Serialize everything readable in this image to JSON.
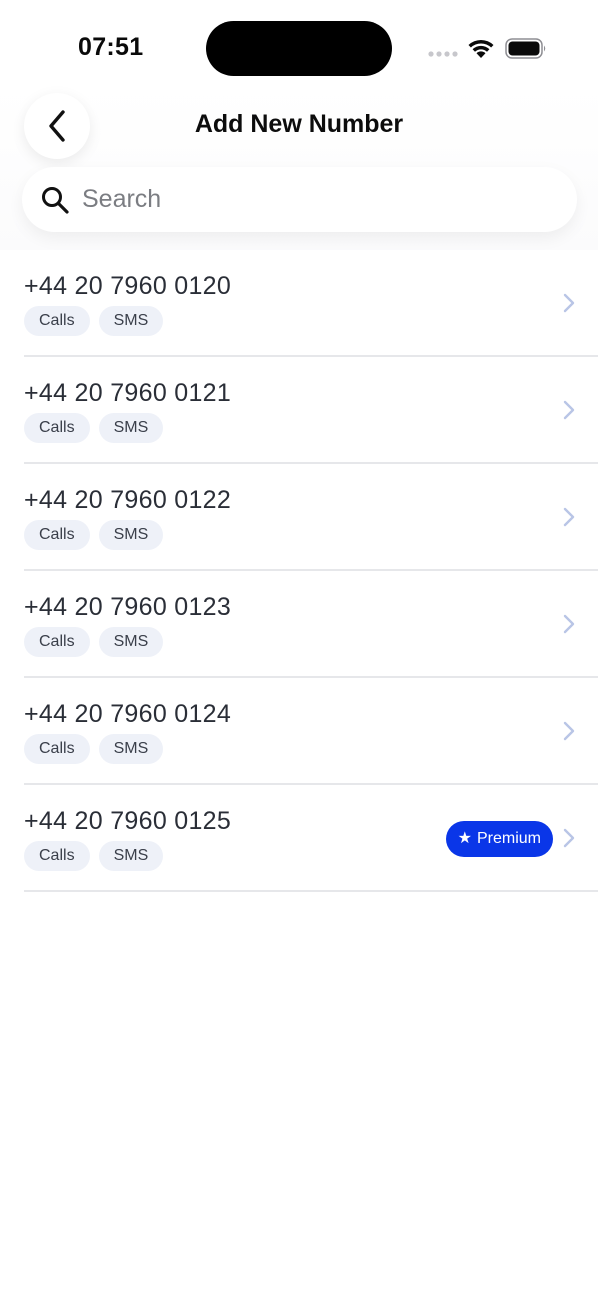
{
  "status_bar": {
    "time": "07:51"
  },
  "header": {
    "title": "Add New Number"
  },
  "search": {
    "placeholder": "Search",
    "value": ""
  },
  "numbers": [
    {
      "number": "+44 20 7960 0120",
      "tags": [
        "Calls",
        "SMS"
      ]
    },
    {
      "number": "+44 20 7960 0121",
      "tags": [
        "Calls",
        "SMS"
      ]
    },
    {
      "number": "+44 20 7960 0122",
      "tags": [
        "Calls",
        "SMS"
      ]
    },
    {
      "number": "+44 20 7960 0123",
      "tags": [
        "Calls",
        "SMS"
      ]
    },
    {
      "number": "+44 20 7960 0124",
      "tags": [
        "Calls",
        "SMS"
      ]
    },
    {
      "number": "+44 20 7960 0125",
      "tags": [
        "Calls",
        "SMS"
      ],
      "badge": "Premium"
    }
  ],
  "icons": {
    "back": "chevron-left-icon",
    "search": "search-icon",
    "row_action": "chevron-right-icon",
    "badge": "star-icon",
    "signal": "cellular-signal-icon",
    "wifi": "wifi-icon",
    "battery": "battery-icon"
  },
  "colors": {
    "accent": "#0a36e8",
    "tag_background": "#eef1f8",
    "chevron": "#b9c5e6",
    "divider": "#e6e7ea"
  }
}
